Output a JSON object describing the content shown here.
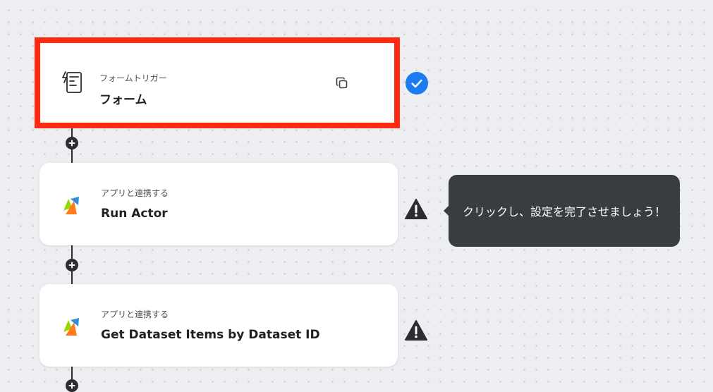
{
  "flow": {
    "steps": [
      {
        "subtitle": "フォームトリガー",
        "title": "フォーム",
        "icon": "form-trigger-icon",
        "status": "completed",
        "selected": true
      },
      {
        "subtitle": "アプリと連携する",
        "title": "Run Actor",
        "icon": "apify-logo-icon",
        "status": "warning"
      },
      {
        "subtitle": "アプリと連携する",
        "title": "Get Dataset Items by Dataset ID",
        "icon": "apify-logo-icon",
        "status": "warning"
      }
    ],
    "tooltip": "クリックし、設定を完了させましょう！"
  },
  "colors": {
    "canvas_bg": "#eceef1",
    "highlight_border": "#ff2a10",
    "success_blue": "#1b7cf2",
    "warning_dark": "#2b2d30",
    "tooltip_bg": "#393c41",
    "apify_green": "#97d700",
    "apify_blue": "#2f8fd8",
    "apify_orange": "#ff7b1c"
  }
}
